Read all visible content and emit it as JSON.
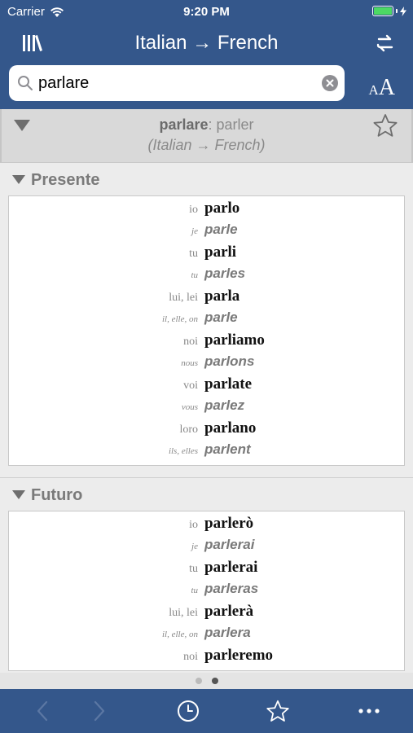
{
  "status": {
    "carrier": "Carrier",
    "time": "9:20 PM"
  },
  "nav": {
    "title": "Italian → French"
  },
  "search": {
    "value": "parlare"
  },
  "font_size": {
    "small": "A",
    "big": "A"
  },
  "entry": {
    "headword": "parlare",
    "translation": ": parler",
    "direction": "(Italian → French)"
  },
  "sections": [
    {
      "label": "Presente",
      "rows": [
        {
          "pron": "io",
          "form": "parlo",
          "lang": "it"
        },
        {
          "pron": "je",
          "form": "parle",
          "lang": "fr"
        },
        {
          "pron": "tu",
          "form": "parli",
          "lang": "it"
        },
        {
          "pron": "tu",
          "form": "parles",
          "lang": "fr"
        },
        {
          "pron": "lui, lei",
          "form": "parla",
          "lang": "it"
        },
        {
          "pron": "il, elle, on",
          "form": "parle",
          "lang": "fr"
        },
        {
          "pron": "noi",
          "form": "parliamo",
          "lang": "it"
        },
        {
          "pron": "nous",
          "form": "parlons",
          "lang": "fr"
        },
        {
          "pron": "voi",
          "form": "parlate",
          "lang": "it"
        },
        {
          "pron": "vous",
          "form": "parlez",
          "lang": "fr"
        },
        {
          "pron": "loro",
          "form": "parlano",
          "lang": "it"
        },
        {
          "pron": "ils, elles",
          "form": "parlent",
          "lang": "fr"
        }
      ]
    },
    {
      "label": "Futuro",
      "rows": [
        {
          "pron": "io",
          "form": "parlerò",
          "lang": "it"
        },
        {
          "pron": "je",
          "form": "parlerai",
          "lang": "fr"
        },
        {
          "pron": "tu",
          "form": "parlerai",
          "lang": "it"
        },
        {
          "pron": "tu",
          "form": "parleras",
          "lang": "fr"
        },
        {
          "pron": "lui, lei",
          "form": "parlerà",
          "lang": "it"
        },
        {
          "pron": "il, elle, on",
          "form": "parlera",
          "lang": "fr"
        },
        {
          "pron": "noi",
          "form": "parleremo",
          "lang": "it"
        }
      ]
    }
  ],
  "page_dots": {
    "count": 2,
    "active": 1
  },
  "icons": {
    "library": "library-icon",
    "swap": "swap-direction-icon",
    "search": "search-icon",
    "clear": "clear-icon",
    "star": "star-icon",
    "back": "chevron-left-icon",
    "forward": "chevron-right-icon",
    "history": "clock-icon",
    "favorites": "star-icon",
    "more": "more-icon"
  },
  "colors": {
    "nav": "#34578b",
    "background": "#ececec",
    "battery": "#4cd964"
  }
}
